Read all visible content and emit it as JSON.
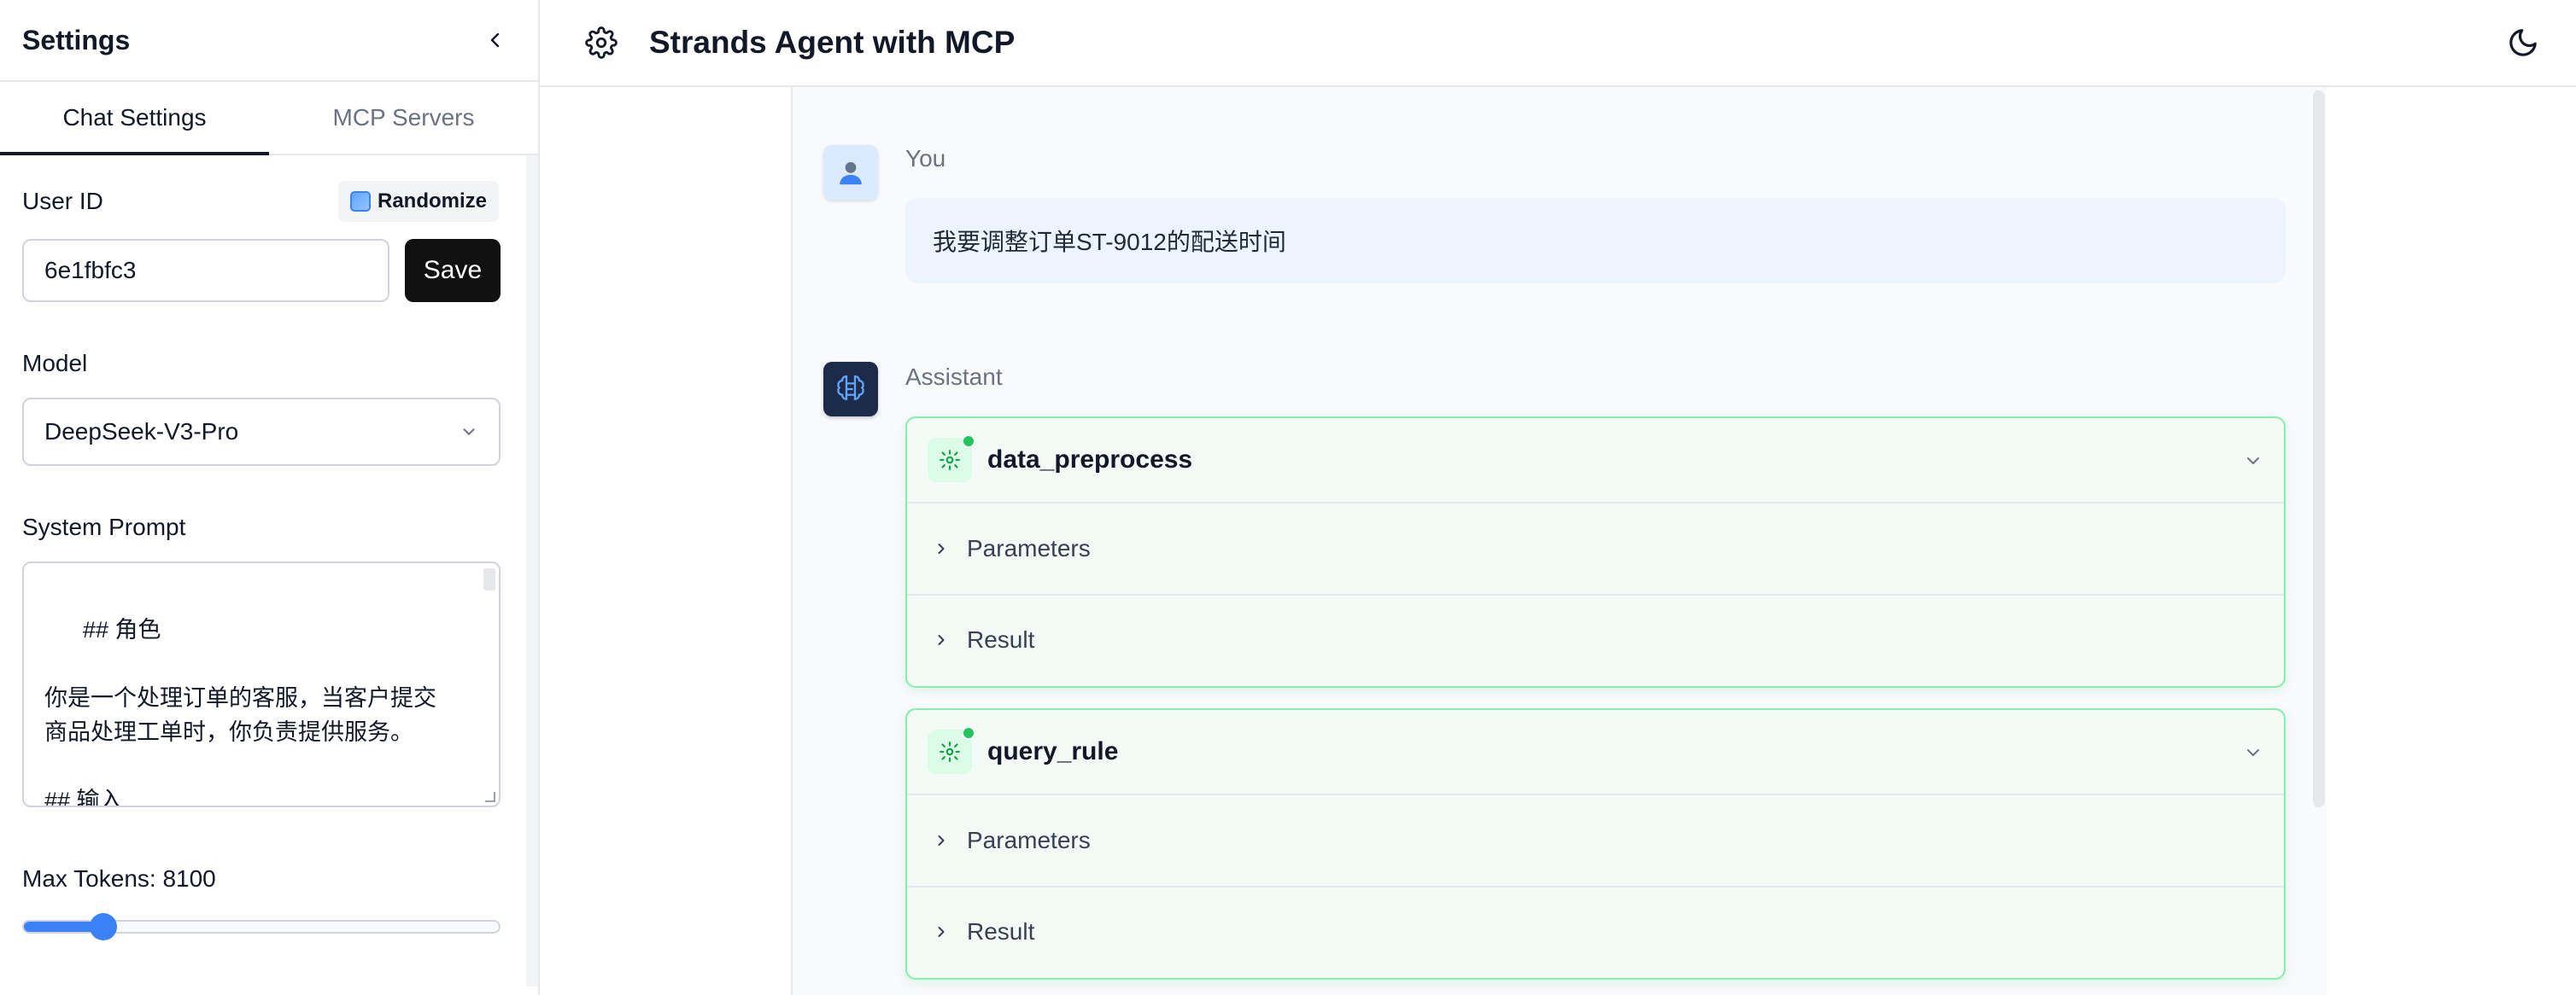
{
  "sidebar": {
    "title": "Settings",
    "tabs": [
      {
        "label": "Chat Settings",
        "active": true
      },
      {
        "label": "MCP Servers",
        "active": false
      }
    ],
    "user_id": {
      "label": "User ID",
      "randomize_label": "Randomize",
      "value": "6e1fbfc3",
      "save_label": "Save"
    },
    "model": {
      "label": "Model",
      "selected": "DeepSeek-V3-Pro"
    },
    "system_prompt": {
      "label": "System Prompt",
      "value": "## 角色\n\n你是一个处理订单的客服，当客户提交\n商品处理工单时，你负责提供服务。\n\n## 输入"
    },
    "max_tokens": {
      "label": "Max Tokens: 8100",
      "fraction": 0.15
    }
  },
  "header": {
    "title": "Strands Agent with MCP"
  },
  "chat": {
    "messages": [
      {
        "role": "You",
        "text": "我要调整订单ST-9012的配送时间"
      },
      {
        "role": "Assistant",
        "tools": [
          {
            "name": "data_preprocess",
            "params_label": "Parameters",
            "result_label": "Result"
          },
          {
            "name": "query_rule",
            "params_label": "Parameters",
            "result_label": "Result"
          }
        ]
      }
    ]
  },
  "colors": {
    "accent": "#3b82f6",
    "tool_border": "#86efac",
    "tool_status": "#22c55e",
    "save_button": "#111111"
  },
  "icons": [
    "chevron-left-icon",
    "gear-icon",
    "moon-icon",
    "user-avatar-icon",
    "brain-circuit-icon",
    "chevron-down-icon",
    "chevron-right-icon"
  ]
}
